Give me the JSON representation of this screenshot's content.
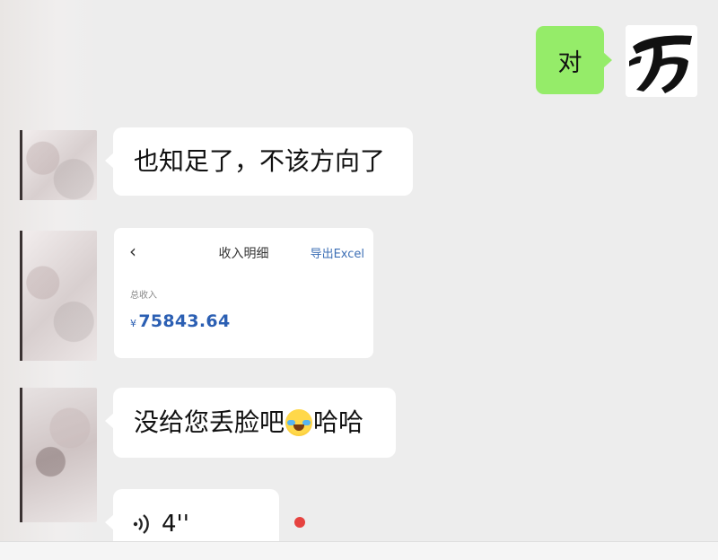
{
  "messages": {
    "sent_1": "对",
    "recv_1": "也知足了，不该方向了",
    "recv_3_before": "没给您丢脸吧",
    "recv_3_after": "哈哈",
    "voice_duration": "4''"
  },
  "shared_card": {
    "back_glyph": "‹",
    "title": "收入明细",
    "export_label": "导出Excel",
    "total_label": "总收入",
    "currency": "¥",
    "amount": "75843.64"
  },
  "icons": {
    "emoji": "tears-of-joy-emoji",
    "voice": "voice-wave-icon",
    "unread": "unread-dot"
  },
  "colors": {
    "sent_bubble": "#95ec69",
    "received_bubble": "#ffffff",
    "background": "#ededed",
    "amount_blue": "#2b5fb3",
    "unread_red": "#e64340"
  }
}
